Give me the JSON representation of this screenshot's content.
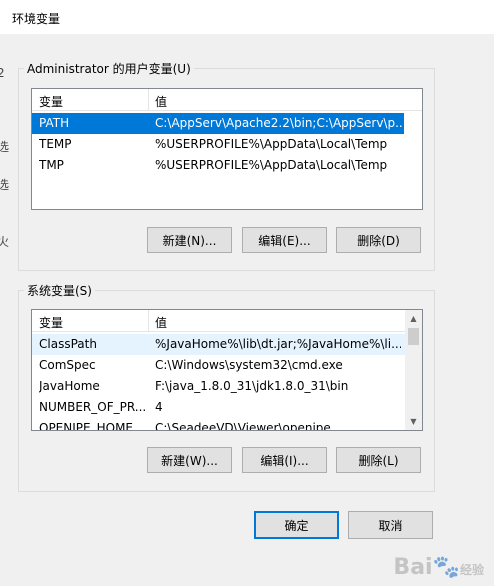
{
  "window": {
    "title": "环境变量"
  },
  "left_strip": [
    "2",
    "选",
    "选",
    "火"
  ],
  "user_vars": {
    "group_label": "Administrator 的用户变量(U)",
    "columns": [
      "变量",
      "值"
    ],
    "rows": [
      {
        "name": "PATH",
        "value": "C:\\AppServ\\Apache2.2\\bin;C:\\AppServ\\p..."
      },
      {
        "name": "TEMP",
        "value": "%USERPROFILE%\\AppData\\Local\\Temp"
      },
      {
        "name": "TMP",
        "value": "%USERPROFILE%\\AppData\\Local\\Temp"
      }
    ],
    "buttons": {
      "new": "新建(N)...",
      "edit": "编辑(E)...",
      "delete": "删除(D)"
    }
  },
  "system_vars": {
    "group_label": "系统变量(S)",
    "columns": [
      "变量",
      "值"
    ],
    "rows": [
      {
        "name": "ClassPath",
        "value": "%JavaHome%\\lib\\dt.jar;%JavaHome%\\li..."
      },
      {
        "name": "ComSpec",
        "value": "C:\\Windows\\system32\\cmd.exe"
      },
      {
        "name": "JavaHome",
        "value": "F:\\java_1.8.0_31\\jdk1.8.0_31\\bin"
      },
      {
        "name": "NUMBER_OF_PR...",
        "value": "4"
      },
      {
        "name": "OPENIPE_HOME",
        "value": "C:\\SeadeeVD\\Viewer\\openipe"
      }
    ],
    "buttons": {
      "new": "新建(W)...",
      "edit": "编辑(I)...",
      "delete": "删除(L)"
    }
  },
  "dialog_buttons": {
    "ok": "确定",
    "cancel": "取消"
  },
  "watermark": {
    "brand": "Bai",
    "suffix": "经验"
  },
  "colors": {
    "selection": "#0078d7",
    "hover": "#e5f3ff",
    "default_button_border": "#0078d7"
  }
}
